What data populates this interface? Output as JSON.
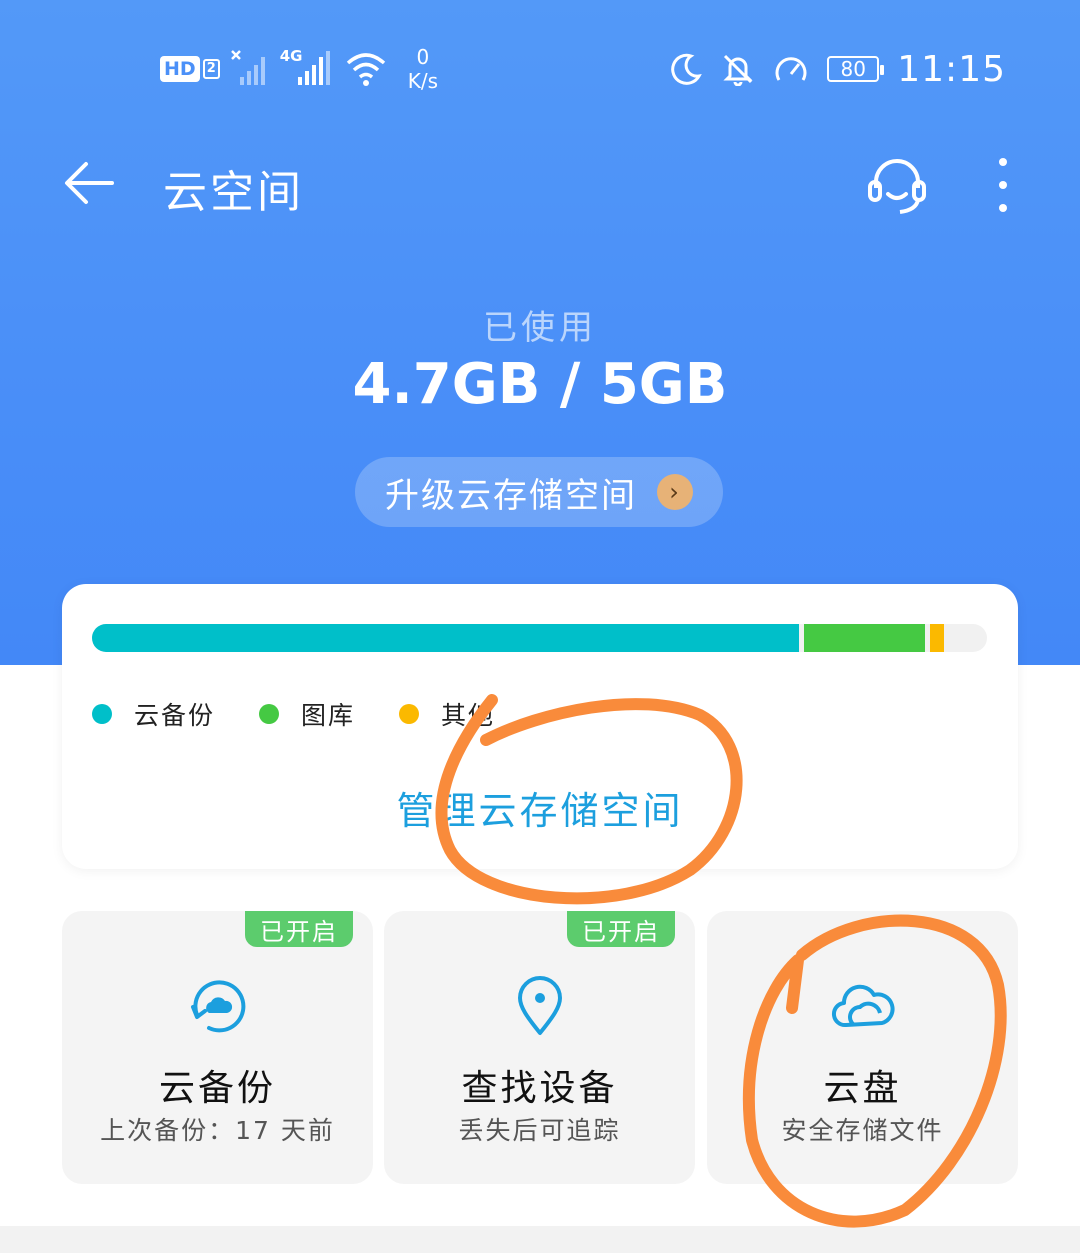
{
  "status_bar": {
    "hd_label": "HD",
    "hd_sub": "2",
    "net_type": "4G",
    "net_speed_value": "0",
    "net_speed_unit": "K/s",
    "battery": "80",
    "time": "11:15"
  },
  "app_bar": {
    "title": "云空间"
  },
  "usage": {
    "label": "已使用",
    "value": "4.7GB / 5GB",
    "used_fraction": 0.94,
    "upgrade_label": "升级云存储空间"
  },
  "storage": {
    "segments": [
      {
        "name": "云备份",
        "fraction": 0.79,
        "color": "#00bfc9"
      },
      {
        "name": "图库",
        "fraction": 0.135,
        "color": "#45c943"
      },
      {
        "name": "其他",
        "fraction": 0.016,
        "color": "#fbb900"
      }
    ],
    "legend": [
      {
        "label": "云备份",
        "color": "#00bfc9"
      },
      {
        "label": "图库",
        "color": "#45c943"
      },
      {
        "label": "其他",
        "color": "#fbb900"
      }
    ],
    "manage_label": "管理云存储空间"
  },
  "tiles": [
    {
      "title": "云备份",
      "subtitle": "上次备份：17 天前",
      "badge": "已开启",
      "icon": "cloud-backup-icon"
    },
    {
      "title": "查找设备",
      "subtitle": "丢失后可追踪",
      "badge": "已开启",
      "icon": "location-pin-icon"
    },
    {
      "title": "云盘",
      "subtitle": "安全存储文件",
      "icon": "cloud-icon"
    }
  ],
  "colors": {
    "header_blue": "#4a8ff8",
    "accent_blue": "#1c9fde",
    "badge_green": "#5ccc6d",
    "annotation_orange": "#f98b3b"
  }
}
